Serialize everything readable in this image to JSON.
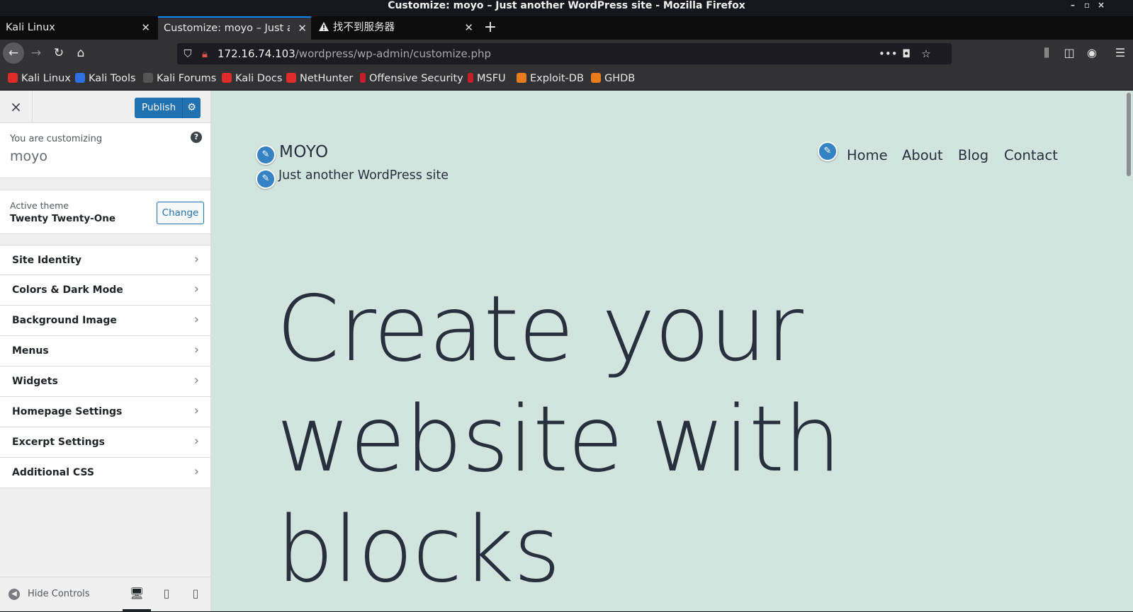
{
  "window": {
    "title": "Customize: moyo – Just another WordPress site - Mozilla Firefox",
    "controls": [
      "–",
      "▫",
      "×"
    ]
  },
  "tabs": [
    {
      "label": "Kali Linux",
      "active": false
    },
    {
      "label": "Customize: moyo – Just another WordPress site",
      "active": true
    },
    {
      "label": "找不到服务器",
      "active": false
    }
  ],
  "nav": {
    "url_host": "172.16.74.103",
    "url_path": "/wordpress/wp-admin/customize.php"
  },
  "bookmarks": [
    {
      "label": "Kali Linux",
      "color": "#e02b2b"
    },
    {
      "label": "Kali Tools",
      "color": "#2f6fe0"
    },
    {
      "label": "Kali Forums",
      "color": "#cccccc"
    },
    {
      "label": "Kali Docs",
      "color": "#e02b2b"
    },
    {
      "label": "NetHunter",
      "color": "#e02b2b"
    },
    {
      "label": "Offensive Security",
      "color": "#c8202b"
    },
    {
      "label": "MSFU",
      "color": "#c8202b"
    },
    {
      "label": "Exploit-DB",
      "color": "#e87b1c"
    },
    {
      "label": "GHDB",
      "color": "#e87b1c"
    }
  ],
  "customizer": {
    "close_icon": "×",
    "publish_label": "Publish",
    "customizing_label": "You are customizing",
    "site_name": "moyo",
    "help_icon": "?",
    "active_theme_label": "Active theme",
    "theme_name": "Twenty Twenty-One",
    "change_label": "Change",
    "sections": [
      "Site Identity",
      "Colors & Dark Mode",
      "Background Image",
      "Menus",
      "Widgets",
      "Homepage Settings",
      "Excerpt Settings",
      "Additional CSS"
    ],
    "hide_controls_label": "Hide Controls"
  },
  "preview": {
    "site_title": "MOYO",
    "tagline": "Just another WordPress site",
    "menu": [
      "Home",
      "About",
      "Blog",
      "Contact"
    ],
    "hero_lines": [
      "Create your",
      "website with",
      "blocks"
    ],
    "background_color": "#d1e4dd",
    "text_color": "#28303d"
  }
}
